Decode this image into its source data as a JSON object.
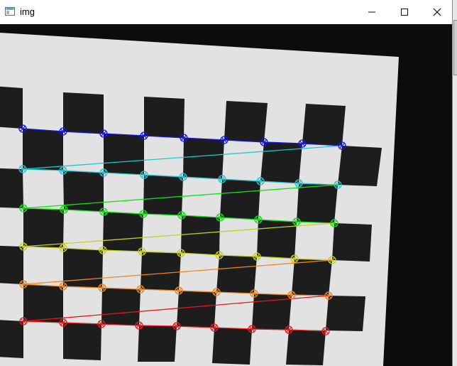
{
  "window": {
    "title": "img",
    "icon": "app-window-icon",
    "controls": [
      "minimize",
      "maximize",
      "close"
    ]
  },
  "colors": {
    "row1": "#1414e6",
    "row2": "#22c4cf",
    "row3": "#12e012",
    "row4": "#c9cf1a",
    "row5": "#f0861e",
    "row6": "#e61818",
    "paper": "#e2e2e2",
    "square": "#1d1d1d",
    "background": "#0c0c0c"
  },
  "pattern": {
    "inner_corners_cols": 9,
    "inner_corners_rows": 6,
    "square_rows": 7,
    "square_cols": 10
  }
}
